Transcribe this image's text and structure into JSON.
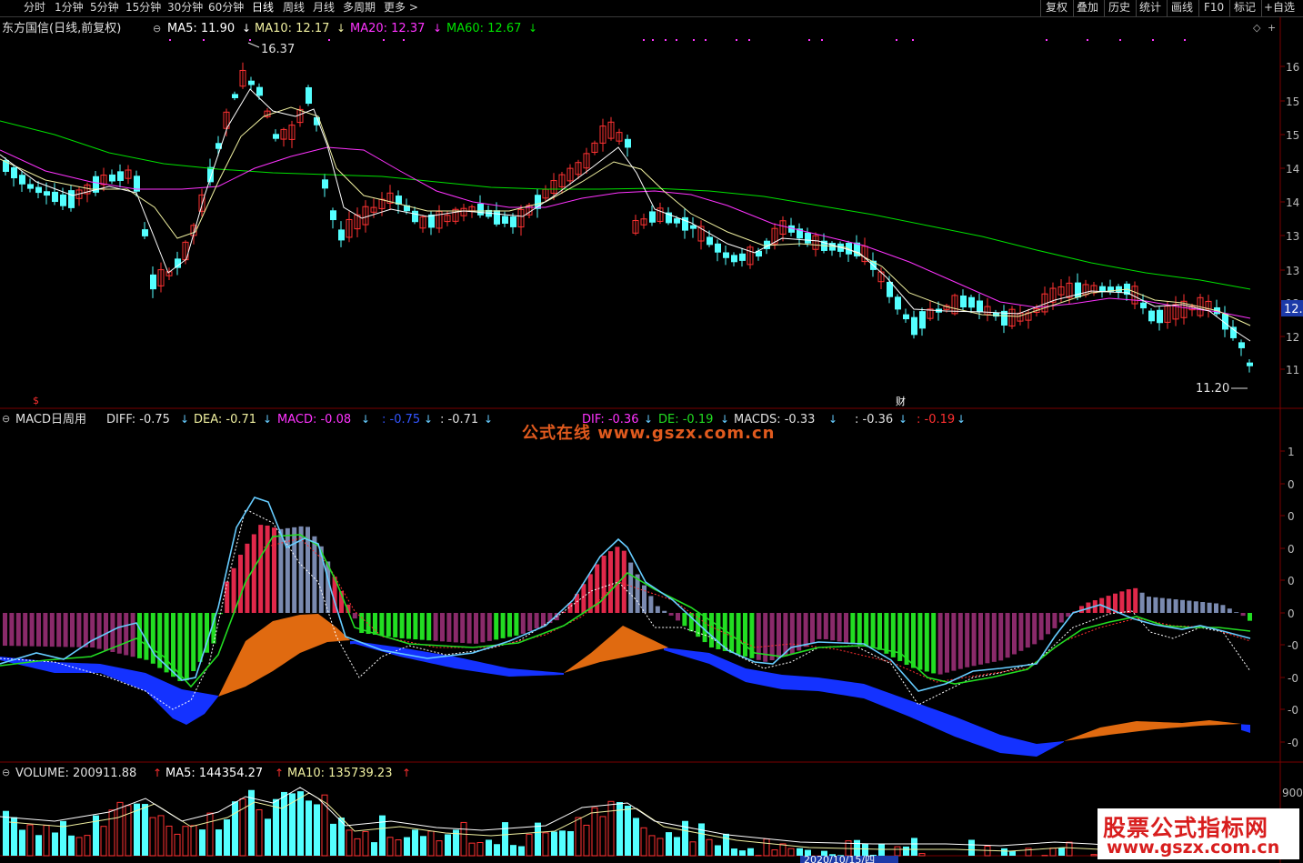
{
  "toolbar": {
    "periods": [
      "分时",
      "1分钟",
      "5分钟",
      "15分钟",
      "30分钟",
      "60分钟",
      "日线",
      "周线",
      "月线",
      "多周期",
      "更多 >"
    ],
    "active_period": "日线",
    "right_buttons": [
      "复权",
      "叠加",
      "历史",
      "统计",
      "画线",
      "F10",
      "标记",
      "+自选"
    ]
  },
  "price_panel": {
    "title": "东方国信(日线,前复权)",
    "ma5": "MA5: 11.90",
    "ma10": "MA10: 12.17",
    "ma20": "MA20: 12.37",
    "ma60": "MA60: 12.67",
    "high_label": "16.37",
    "low_label": "11.20",
    "current_price_tag": "12.",
    "marker_s": "$",
    "marker_cai": "财",
    "y_ticks": [
      "16",
      "15",
      "15",
      "14",
      "14",
      "13",
      "13",
      "12",
      "12",
      "11"
    ]
  },
  "macd_panel": {
    "title": "MACD日周用",
    "diff": "DIFF: -0.75",
    "dea": "DEA: -0.71",
    "macd": "MACD: -0.08",
    "blank1": ": -0.75",
    "blank2": ": -0.71",
    "dif": "DIF: -0.36",
    "de": "DE: -0.19",
    "macds": "MACDS: -0.33",
    "blank3": ": -0.36",
    "blank4": ": -0.19",
    "y_ticks": [
      "1",
      "0",
      "0",
      "0",
      "0",
      "0",
      "-0",
      "-0",
      "-0",
      "-0"
    ]
  },
  "volume_panel": {
    "volume": "VOLUME: 200911.88",
    "ma5": "MA5: 144354.27",
    "ma10": "MA10: 135739.23",
    "y_tick": "900"
  },
  "date_axis": {
    "highlighted_date": "2020/10/15/四"
  },
  "watermarks": {
    "top": "公式在线  www.gszx.com.cn",
    "corner_line1": "股票公式指标网",
    "corner_line2": "www.gszx.com.cn"
  },
  "colors": {
    "up": "#ff3232",
    "down": "#54ffff",
    "ma5": "#ffffff",
    "ma10": "#f0f0a0",
    "ma20": "#ff33ff",
    "ma60": "#00e000",
    "macd_pos": "#e0284a",
    "macd_neg_green": "#22dd22",
    "macd_neg_purple": "#8a2a6a",
    "orange_band": "#e06a10",
    "blue_band": "#1432ff",
    "diff_line": "#66ccff",
    "dea_line": "#22dd22"
  }
}
